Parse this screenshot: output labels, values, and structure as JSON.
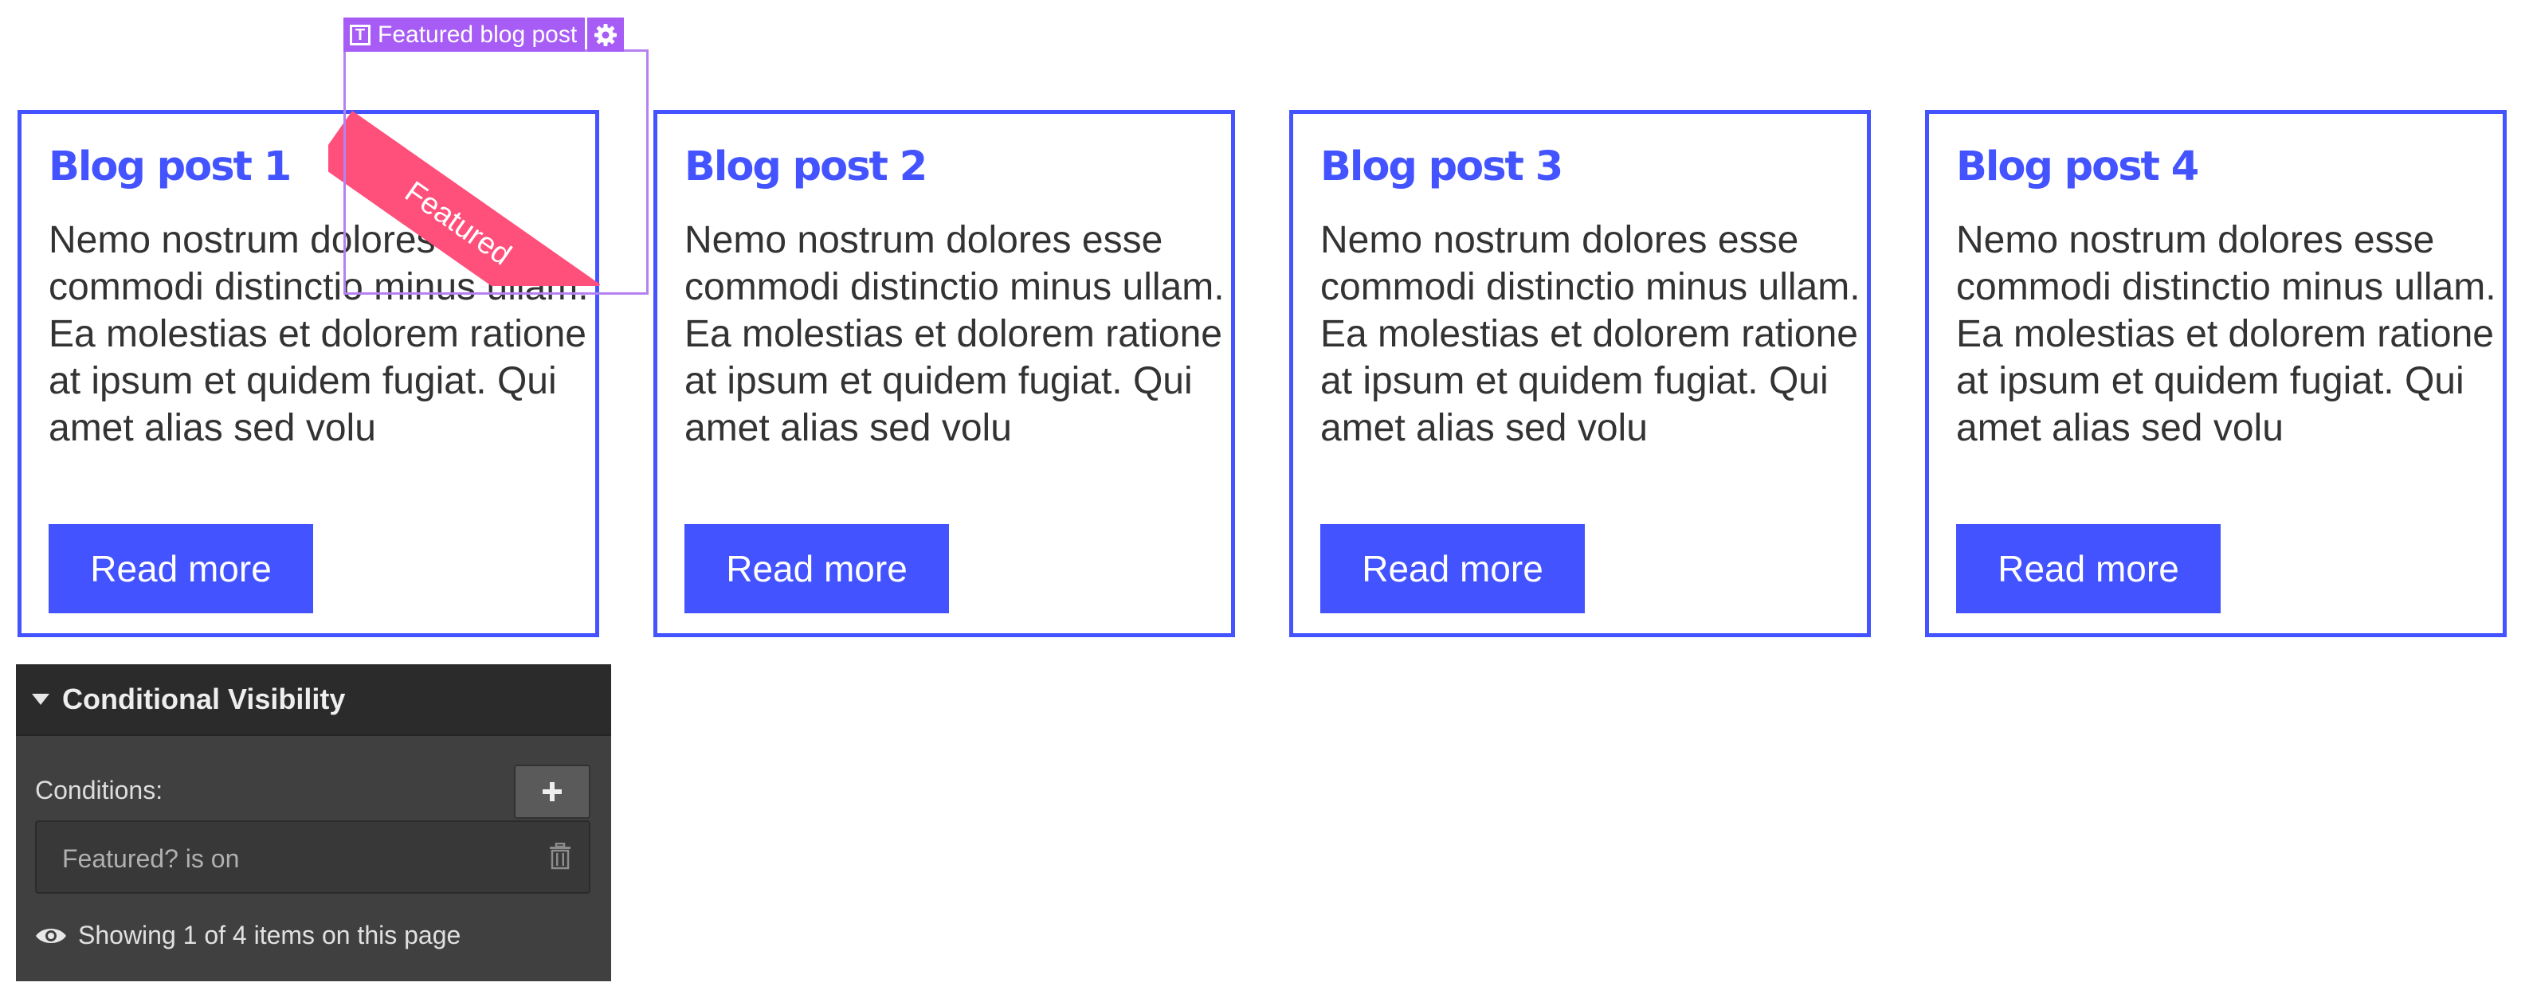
{
  "selection": {
    "label": "Featured blog post",
    "type_icon_glyph": "T",
    "type_icon": "text-block-icon",
    "settings_icon": "gear-icon",
    "accent_color": "#a75cf5"
  },
  "ribbon": {
    "label": "Featured",
    "color": "#ff4f7b"
  },
  "cards": [
    {
      "title": "Blog post 1",
      "body": "Nemo nostrum dolores esse commodi distinctio minus ullam. Ea molestias et dolorem ratione at ipsum et quidem fugiat. Qui amet alias sed volu",
      "button_label": "Read more"
    },
    {
      "title": "Blog post 2",
      "body": "Nemo nostrum dolores esse commodi distinctio minus ullam. Ea molestias et dolorem ratione at ipsum et quidem fugiat. Qui amet alias sed volu",
      "button_label": "Read more"
    },
    {
      "title": "Blog post 3",
      "body": "Nemo nostrum dolores esse commodi distinctio minus ullam. Ea molestias et dolorem ratione at ipsum et quidem fugiat. Qui amet alias sed volu",
      "button_label": "Read more"
    },
    {
      "title": "Blog post 4",
      "body": "Nemo nostrum dolores esse commodi distinctio minus ullam. Ea molestias et dolorem ratione at ipsum et quidem fugiat. Qui amet alias sed volu",
      "button_label": "Read more"
    }
  ],
  "card_accent_color": "#4353ff",
  "panel": {
    "title": "Conditional Visibility",
    "collapse_icon": "caret-down-icon",
    "conditions_label": "Conditions:",
    "add_icon": "plus-icon",
    "condition": "Featured? is on",
    "delete_icon": "trash-icon",
    "visibility_icon": "eye-icon",
    "showing_text": "Showing 1 of 4 items on this page"
  }
}
